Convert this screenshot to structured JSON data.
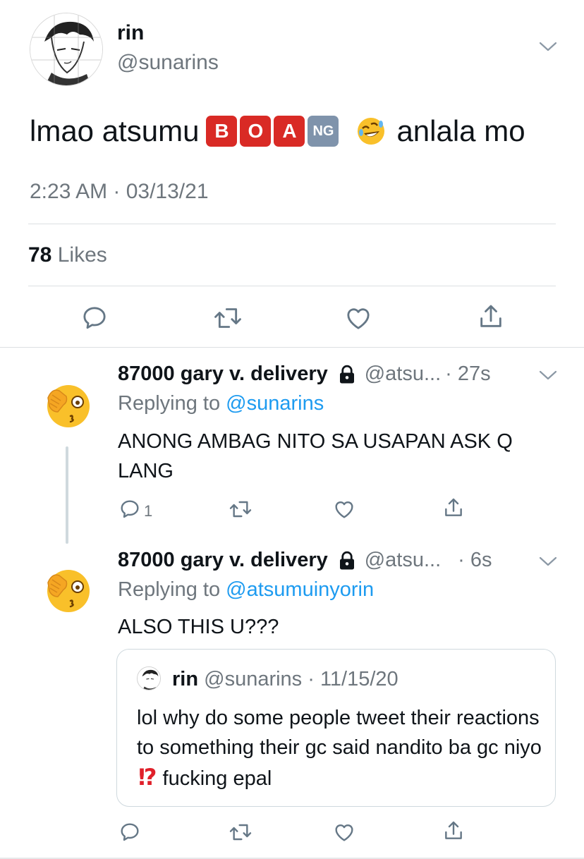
{
  "main_tweet": {
    "author_name": "rin",
    "author_handle": "@sunarins",
    "text_before": "lmao atsumu",
    "emoji_tiles": [
      "B",
      "O",
      "A",
      "NG"
    ],
    "text_after": "anlala mo",
    "timestamp": "2:23 AM · 03/13/21",
    "likes_count": "78",
    "likes_label": "Likes",
    "icons": [
      "reply-icon",
      "retweet-icon",
      "like-icon",
      "share-icon"
    ]
  },
  "replies": [
    {
      "author_name": "87000 gary v. delivery",
      "author_handle": "@atsu...",
      "time": "· 27s",
      "replying_label": "Replying to",
      "replying_to": "@sunarins",
      "text": "ANONG AMBAG NITO SA USAPAN ASK Q LANG",
      "reply_count": "1"
    },
    {
      "author_name": "87000 gary v. delivery",
      "author_handle": "@atsu...",
      "time": "· 6s",
      "replying_label": "Replying to",
      "replying_to": "@atsumuinyorin",
      "text": "ALSO THIS U???",
      "quote": {
        "author_name": "rin",
        "meta": "@sunarins · 11/15/20",
        "text_before": "lol why do some people tweet their reactions to something their gc said nandito ba gc niyo",
        "text_after": "fucking epal"
      }
    }
  ],
  "colors": {
    "text": "#0f1419",
    "secondary": "#6e767d",
    "link": "#1d9bf0",
    "divider": "#dcdfe2",
    "emoji_red": "#d92a25",
    "emoji_gray": "#7f93ab"
  }
}
